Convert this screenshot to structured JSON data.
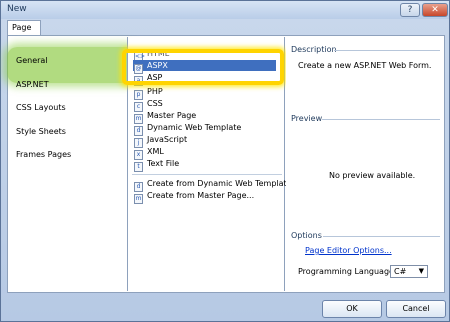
{
  "window": {
    "title": "New",
    "help": "?",
    "close": "✕"
  },
  "tab": {
    "label": "Page"
  },
  "categories": [
    "General",
    "ASP.NET",
    "CSS Layouts",
    "Style Sheets",
    "Frames Pages"
  ],
  "templates": {
    "partial_top": "HTML",
    "items": [
      {
        "label": "ASPX",
        "icon": "aspx-file-icon",
        "selected": true
      },
      {
        "label": "ASP",
        "icon": "asp-file-icon"
      },
      {
        "label": "PHP",
        "icon": "php-file-icon"
      },
      {
        "label": "CSS",
        "icon": "css-file-icon"
      },
      {
        "label": "Master Page",
        "icon": "master-page-icon"
      },
      {
        "label": "Dynamic Web Template",
        "icon": "dwt-file-icon"
      },
      {
        "label": "JavaScript",
        "icon": "javascript-file-icon"
      },
      {
        "label": "XML",
        "icon": "xml-file-icon"
      },
      {
        "label": "Text File",
        "icon": "text-file-icon"
      }
    ],
    "actions": [
      {
        "label": "Create from Dynamic Web Template...",
        "icon": "dwt-create-icon"
      },
      {
        "label": "Create from Master Page...",
        "icon": "master-create-icon"
      }
    ]
  },
  "description": {
    "heading": "Description",
    "text": "Create a new ASP.NET Web Form."
  },
  "preview": {
    "heading": "Preview",
    "text": "No preview available."
  },
  "options": {
    "heading": "Options",
    "link": "Page Editor Options...",
    "language_label": "Programming Language:",
    "language_value": "C#"
  },
  "buttons": {
    "ok": "OK",
    "cancel": "Cancel"
  },
  "colors": {
    "highlight_green": "#87c83c",
    "callout_yellow": "#ffd400",
    "selection": "#3f6fbf"
  }
}
